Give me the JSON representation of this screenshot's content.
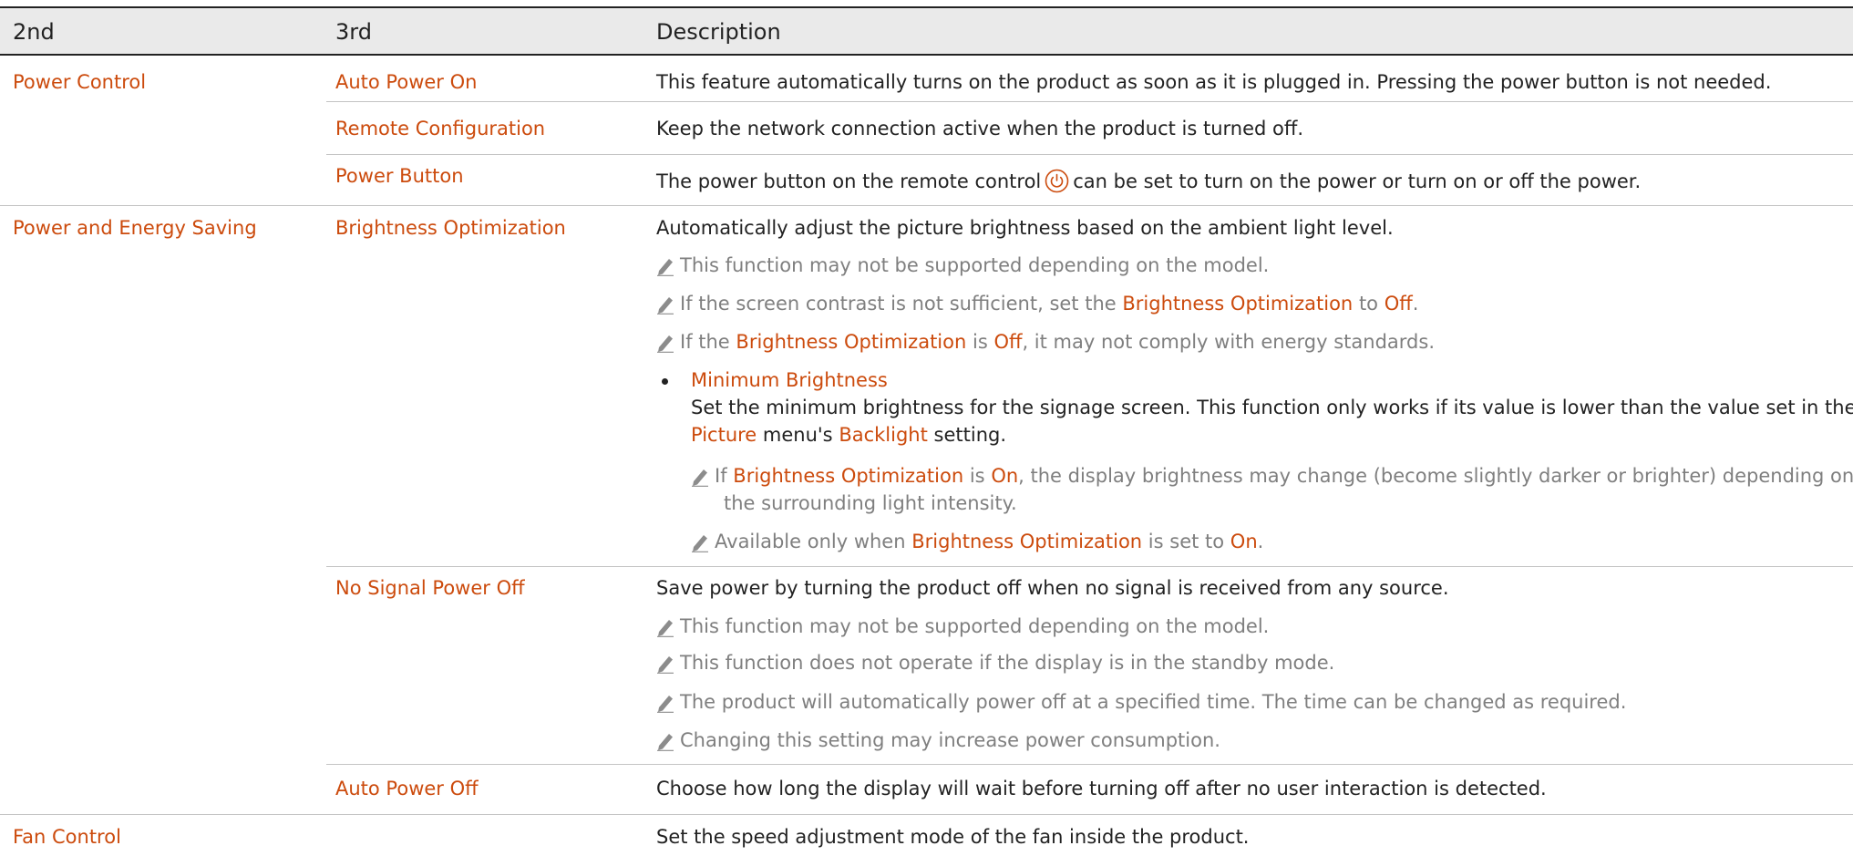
{
  "header": {
    "col2": "2nd",
    "col3": "3rd",
    "col4": "Description"
  },
  "power_control": {
    "section": "Power Control",
    "auto_power_on": {
      "name": "Auto Power On",
      "desc": "This feature automatically turns on the product as soon as it is plugged in. Pressing the power button is not needed."
    },
    "remote_config": {
      "name": "Remote Configuration",
      "desc": "Keep the network connection active when the product is turned off."
    },
    "power_button": {
      "name": "Power Button",
      "desc_a": "The power button on the remote control",
      "desc_b": "can be set to turn on the power or turn on or off the power."
    }
  },
  "energy_saving": {
    "section": "Power and Energy Saving",
    "brightness": {
      "name": "Brightness Optimization",
      "desc": "Automatically adjust the picture brightness based on the ambient light level.",
      "note1": "This function may not be supported depending on the model.",
      "note2_a": "If the screen contrast is not sufficient, set the",
      "note2_b": "Brightness Optimization",
      "note2_c": "to",
      "note2_d": "Off",
      "note2_e": ".",
      "note3_a": "If the",
      "note3_b": "Brightness Optimization",
      "note3_c": "is",
      "note3_d": "Off",
      "note3_e": ", it may not comply with energy standards.",
      "min": {
        "title": "Minimum Brightness",
        "line1": "Set the minimum brightness for the signage screen. This function only works if its value is lower than the value set in the",
        "line2_a": "Picture",
        "line2_b": "menu's",
        "line2_c": "Backlight",
        "line2_d": "setting.",
        "sub1_a": "If",
        "sub1_b": "Brightness Optimization",
        "sub1_c": "is",
        "sub1_d": "On",
        "sub1_e": ", the display brightness may change (become slightly darker or brighter) depending on",
        "sub1_f": "the surrounding light intensity.",
        "sub2_a": "Available only when",
        "sub2_b": "Brightness Optimization",
        "sub2_c": "is set to",
        "sub2_d": "On",
        "sub2_e": "."
      }
    },
    "no_signal": {
      "name": "No Signal Power Off",
      "desc": "Save power by turning the product off when no signal is received from any source.",
      "note1": "This function may not be supported depending on the model.",
      "note2": "This function does not operate if the display is in the standby mode.",
      "note3": "The product will automatically power off at a specified time. The time can be changed as required.",
      "note4": "Changing this setting may increase power consumption."
    },
    "auto_power_off": {
      "name": "Auto Power Off",
      "desc": "Choose how long the display will wait before turning off after no user interaction is detected."
    }
  },
  "fan_control": {
    "section": "Fan Control",
    "desc": "Set the speed adjustment mode of the fan inside the product."
  }
}
